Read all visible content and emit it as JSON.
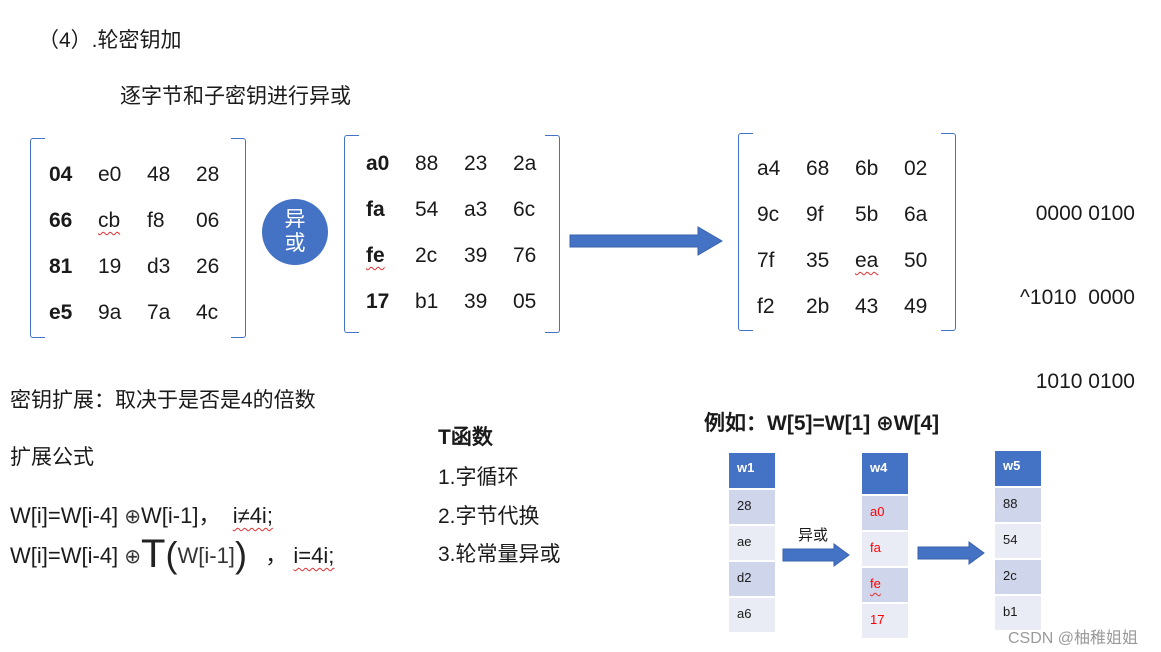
{
  "section_title": "（4）.轮密钥加",
  "subtitle": "逐字节和子密钥进行异或",
  "state_matrix": {
    "rows": [
      [
        "04",
        "e0",
        "48",
        "28"
      ],
      [
        "66",
        "cb",
        "f8",
        "06"
      ],
      [
        "81",
        "19",
        "d3",
        "26"
      ],
      [
        "e5",
        "9a",
        "7a",
        "4c"
      ]
    ]
  },
  "xor_symbol": {
    "line1": "异",
    "line2": "或",
    "color": "#4472c4"
  },
  "round_key_matrix": {
    "rows": [
      [
        "a0",
        "88",
        "23",
        "2a"
      ],
      [
        "fa",
        "54",
        "a3",
        "6c"
      ],
      [
        "fe",
        "2c",
        "39",
        "76"
      ],
      [
        "17",
        "b1",
        "39",
        "05"
      ]
    ]
  },
  "result_matrix": {
    "rows": [
      [
        "a4",
        "68",
        "6b",
        "02"
      ],
      [
        "9c",
        "9f",
        "5b",
        "6a"
      ],
      [
        "7f",
        "35",
        "ea",
        "50"
      ],
      [
        "f2",
        "2b",
        "43",
        "49"
      ]
    ]
  },
  "binary_example": {
    "line1": "0000 0100",
    "line2": "^1010  0000",
    "line3": "1010 0100"
  },
  "key_expansion": {
    "heading": "密钥扩展：取决于是否是4的倍数",
    "formula_heading": "扩展公式",
    "formula1": {
      "lhs": "W[i]=W[i-4] ",
      "op": "⊕",
      "rhs": "W[i-1]，",
      "cond": "i≠4i;"
    },
    "formula2": {
      "lhs": "W[i]=W[i-4] ",
      "op": "⊕",
      "func": "T",
      "open": "(",
      "arg": "W[i-1]",
      "close": ")",
      "sep": "，",
      "cond": "i=4i;"
    }
  },
  "t_function": {
    "title": "T函数",
    "items": [
      "1.字循环",
      "2.字节代换",
      "3.轮常量异或"
    ]
  },
  "example": {
    "title": "例如：W[5]=W[1] ⊕W[4]",
    "xor_label": "异或",
    "columns": [
      {
        "header": "w1",
        "values": [
          "28",
          "ae",
          "d2",
          "a6"
        ],
        "highlight": false
      },
      {
        "header": "w4",
        "values": [
          "a0",
          "fa",
          "fe",
          "17"
        ],
        "highlight": true
      },
      {
        "header": "w5",
        "values": [
          "88",
          "54",
          "2c",
          "b1"
        ],
        "highlight": false
      }
    ],
    "colors": {
      "header": "#4472c4",
      "row_dark": "#cfd5ea",
      "row_light": "#e9ebf5",
      "highlight_text": "#ff0000"
    }
  },
  "watermark": "CSDN @柚稚姐姐"
}
